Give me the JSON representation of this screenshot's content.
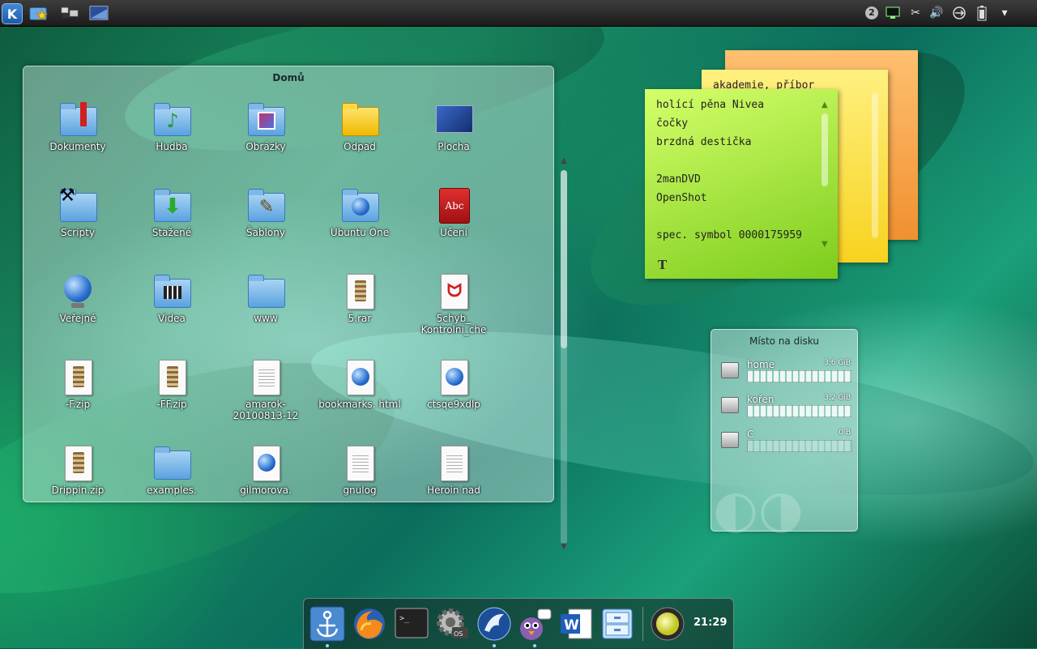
{
  "panel": {
    "launcher_icon": "kde-logo-icon",
    "quicklaunch": [
      "favorites-folder-icon",
      "devices-icon",
      "desktop-icon"
    ],
    "tray": {
      "pager_label": "2",
      "icons": [
        "pager-icon",
        "network-icon",
        "klipper-icon",
        "volume-icon",
        "usb-icon",
        "battery-icon",
        "menu-arrow-icon"
      ]
    }
  },
  "folderview": {
    "title": "Domů",
    "items": [
      {
        "label": "Dokumenty",
        "icon": "documents-folder-icon"
      },
      {
        "label": "Hudba",
        "icon": "music-folder-icon"
      },
      {
        "label": "Obrázky",
        "icon": "pictures-folder-icon"
      },
      {
        "label": "Odpad",
        "icon": "trash-folder-icon"
      },
      {
        "label": "Plocha",
        "icon": "desktop-folder-icon"
      },
      {
        "label": "Scripty",
        "icon": "scripts-folder-icon"
      },
      {
        "label": "Stažené",
        "icon": "downloads-folder-icon"
      },
      {
        "label": "Šablony",
        "icon": "templates-folder-icon"
      },
      {
        "label": "Ubuntu One",
        "icon": "ubuntu-one-folder-icon"
      },
      {
        "label": "Učení",
        "icon": "dictionary-icon"
      },
      {
        "label": "Veřejné",
        "icon": "public-globe-icon"
      },
      {
        "label": "Videa",
        "icon": "videos-folder-icon"
      },
      {
        "label": "www",
        "icon": "www-folder-icon"
      },
      {
        "label": "5.rar",
        "icon": "archive-icon"
      },
      {
        "label": "5chyb_ Kontrolni_che",
        "icon": "pdf-icon"
      },
      {
        "label": "-F.zip",
        "icon": "zip-icon"
      },
      {
        "label": "-FF.zip",
        "icon": "zip-icon"
      },
      {
        "label": "amarok- 20100813-12",
        "icon": "text-file-icon"
      },
      {
        "label": "bookmarks. html",
        "icon": "html-file-icon"
      },
      {
        "label": "ctsqe9xdlp",
        "icon": "html-file-icon"
      },
      {
        "label": "Drippin.zip",
        "icon": "zip-icon"
      },
      {
        "label": "examples.",
        "icon": "folder-icon"
      },
      {
        "label": "gilmorova.",
        "icon": "html-file-icon"
      },
      {
        "label": "gnulog",
        "icon": "text-file-icon"
      },
      {
        "label": "Heroin nad",
        "icon": "text-file-icon"
      }
    ]
  },
  "notes": {
    "back_orange": "",
    "back_yellow": "akademie, příbor",
    "front": {
      "lines": [
        "holící pěna Nivea",
        "čočky",
        "brzdná destička",
        "",
        "2manDVD",
        "OpenShot",
        "",
        "spec. symbol 0000175959"
      ],
      "format_icon": "T"
    }
  },
  "disk": {
    "title": "Místo na disku",
    "rows": [
      {
        "name": "home",
        "size": "3,6 GiB"
      },
      {
        "name": "kořen",
        "size": "3,2 GiB"
      },
      {
        "name": "C",
        "size": "0 B"
      }
    ]
  },
  "dock": {
    "items": [
      "anchor-icon",
      "firefox-icon",
      "terminal-icon",
      "settings-gear-icon",
      "seamonkey-icon",
      "pidgin-icon",
      "word-icon",
      "file-cabinet-icon",
      "moon-icon"
    ],
    "clock": "21:29"
  },
  "colors": {
    "panel": "#2a2a2a",
    "note_green": "#a6e03c",
    "note_yellow": "#f7d21e",
    "note_orange": "#f09030"
  }
}
